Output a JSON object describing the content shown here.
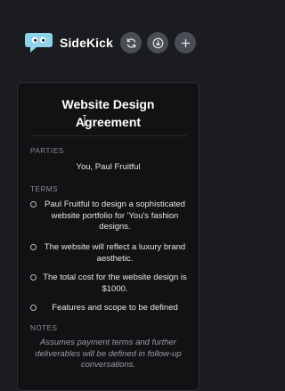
{
  "header": {
    "app_title": "SideKick",
    "buttons": [
      {
        "icon": "refresh-icon"
      },
      {
        "icon": "download-icon"
      },
      {
        "icon": "plus-icon"
      }
    ],
    "logo_color": "#7ec8e3"
  },
  "document": {
    "title_line1": "Website Design",
    "title_line2": "Agreement",
    "parties_label": "PARTIES",
    "parties_value": "You, Paul Fruitful",
    "terms_label": "TERMS",
    "terms": [
      "Paul Fruitful to design a sophisticated website portfolio for 'You's fashion designs.",
      "The website will reflect a luxury brand aesthetic.",
      "The total cost for the website design is $1000.",
      "Features and scope to be defined"
    ],
    "notes_label": "NOTES",
    "notes_text": "Assumes payment terms and further deliverables will be defined in follow-up conversations."
  }
}
